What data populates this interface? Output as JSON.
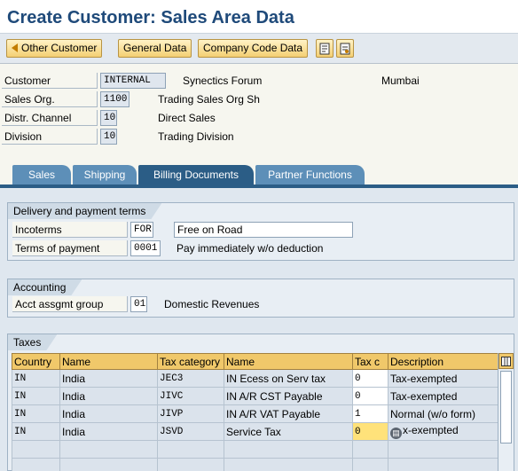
{
  "window": {
    "title": "Create Customer: Sales Area Data"
  },
  "toolbar": {
    "other_customer": "Other Customer",
    "general_data": "General Data",
    "company_code_data": "Company Code Data"
  },
  "header": {
    "customer": {
      "label": "Customer",
      "value": "INTERNAL",
      "name": "Synectics Forum",
      "city": "Mumbai"
    },
    "sales_org": {
      "label": "Sales Org.",
      "value": "1100",
      "desc": "Trading Sales Org Sh"
    },
    "distr_channel": {
      "label": "Distr. Channel",
      "value": "10",
      "desc": "Direct Sales"
    },
    "division": {
      "label": "Division",
      "value": "10",
      "desc": "Trading Division"
    }
  },
  "tabs": [
    "Sales",
    "Shipping",
    "Billing Documents",
    "Partner Functions"
  ],
  "active_tab": "Billing Documents",
  "delivery": {
    "title": "Delivery and payment terms",
    "incoterms_label": "Incoterms",
    "incoterms_code": "FOR",
    "incoterms_text": "Free on Road",
    "terms_label": "Terms of payment",
    "terms_code": "0001",
    "terms_desc": "Pay immediately w/o deduction"
  },
  "accounting": {
    "title": "Accounting",
    "acct_label": "Acct assgmt group",
    "acct_code": "01",
    "acct_desc": "Domestic Revenues"
  },
  "taxes": {
    "title": "Taxes",
    "columns": [
      "Country",
      "Name",
      "Tax category",
      "Name",
      "Tax c",
      "Description"
    ],
    "rows": [
      [
        "IN",
        "India",
        "JEC3",
        "IN Ecess on Serv tax",
        "0",
        "Tax-exempted"
      ],
      [
        "IN",
        "India",
        "JIVC",
        "IN A/R CST Payable",
        "0",
        "Tax-exempted"
      ],
      [
        "IN",
        "India",
        "JIVP",
        "IN A/R VAT Payable",
        "1",
        "Normal (w/o form)"
      ],
      [
        "IN",
        "India",
        "JSVD",
        "Service Tax",
        "0",
        "x-exempted"
      ]
    ]
  },
  "colors": {
    "title": "#1f4a7a",
    "tab": "#5d8fb8",
    "tab_active": "#2b5d86",
    "header_cell": "#f0c86a"
  }
}
